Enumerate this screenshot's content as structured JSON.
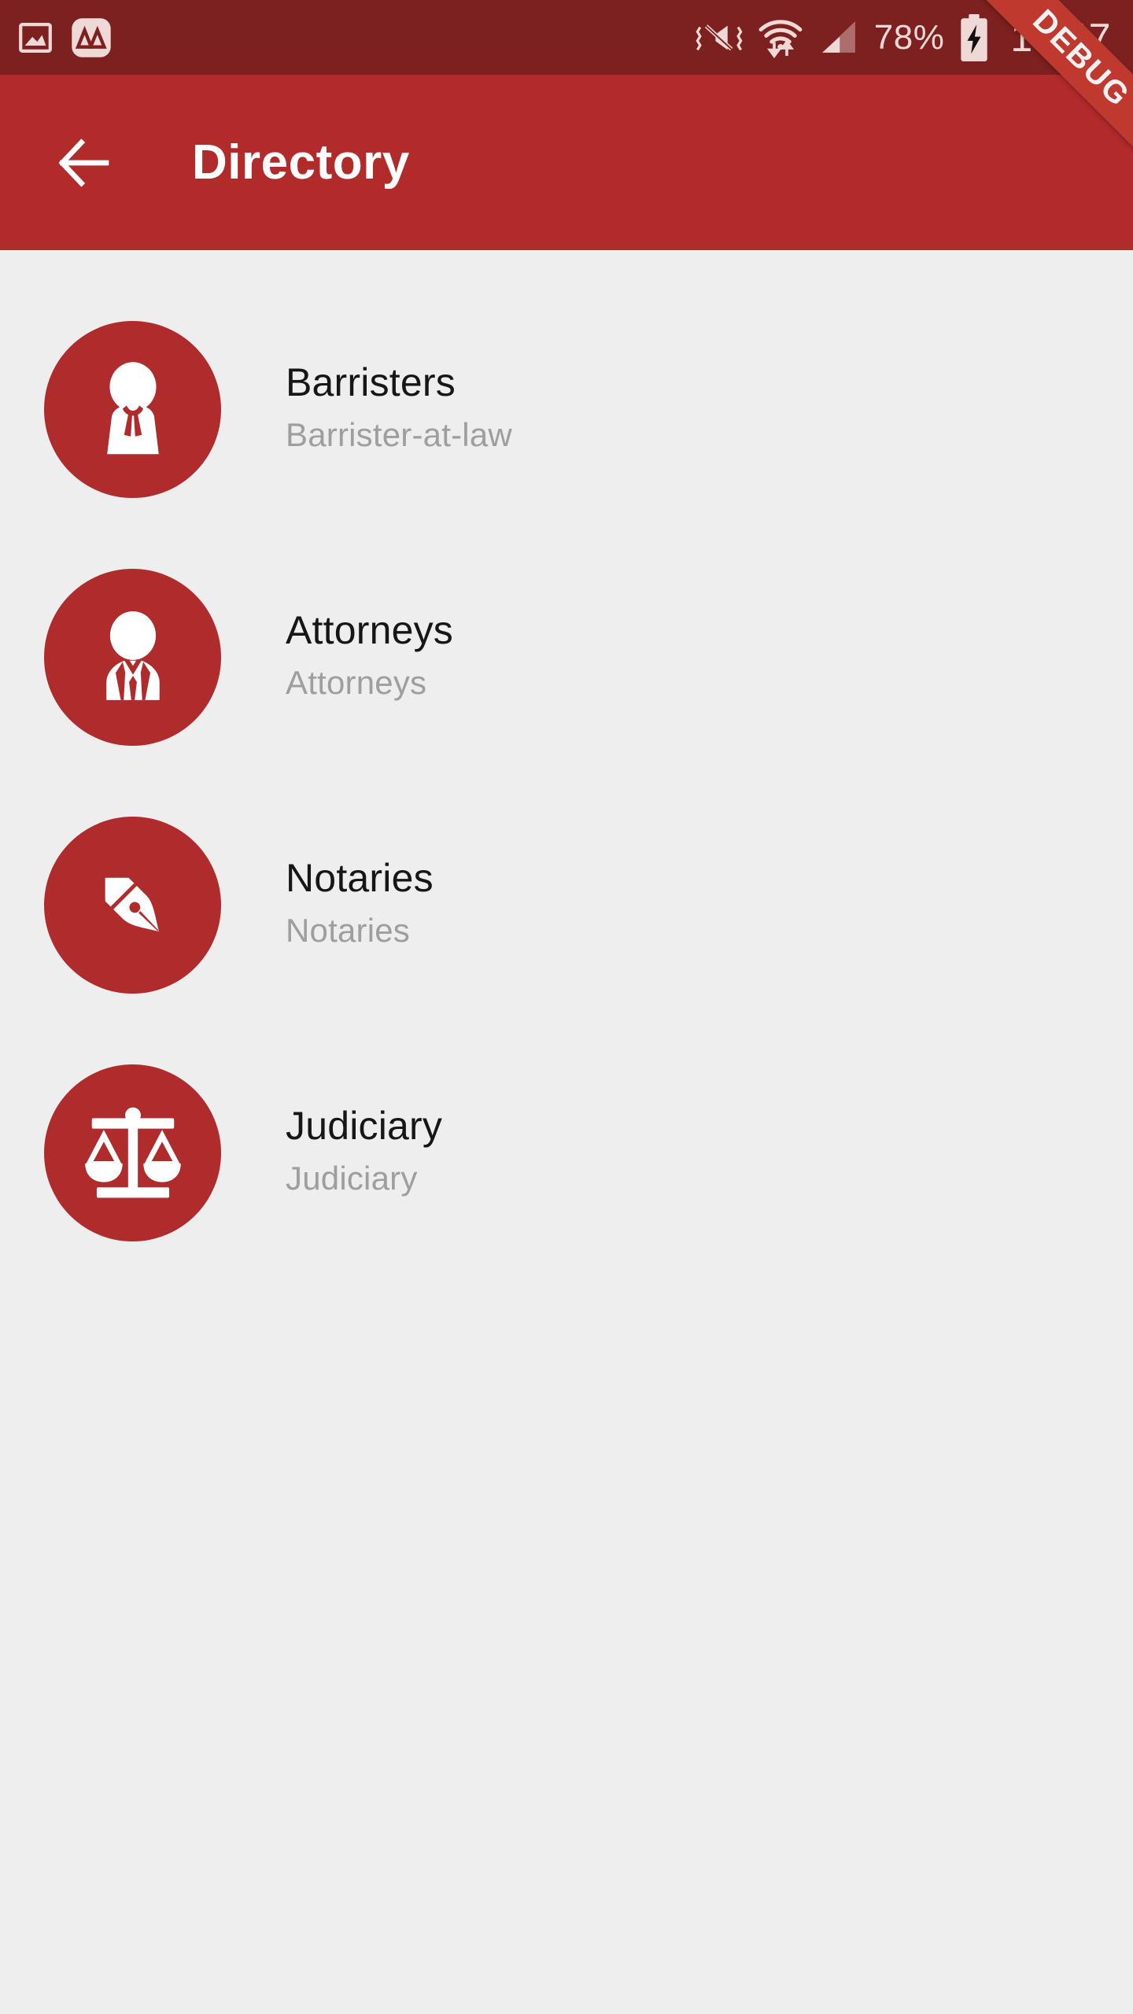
{
  "status_bar": {
    "battery_percent": "78%",
    "clock": "13:47",
    "left_icons": [
      {
        "name": "screenshot-image-icon"
      },
      {
        "name": "app-badge-mountain-icon"
      }
    ],
    "right_icons": [
      {
        "name": "vibrate-mute-icon"
      },
      {
        "name": "wifi-data-transfer-icon"
      },
      {
        "name": "cellular-signal-icon"
      },
      {
        "name": "battery-charging-icon"
      }
    ],
    "colors": {
      "background": "#7D2020",
      "foreground": "#EFD9D7"
    }
  },
  "debug_ribbon": {
    "label": "DEBUG",
    "color": "#C0392F"
  },
  "app_bar": {
    "back_icon": "arrow-back-icon",
    "title": "Directory",
    "color": "#B22B2B"
  },
  "directory": {
    "items": [
      {
        "title": "Barristers",
        "subtitle": "Barrister-at-law",
        "icon": "barrister-avatar-icon"
      },
      {
        "title": "Attorneys",
        "subtitle": "Attorneys",
        "icon": "attorney-avatar-icon"
      },
      {
        "title": "Notaries",
        "subtitle": "Notaries",
        "icon": "fountain-pen-nib-icon"
      },
      {
        "title": "Judiciary",
        "subtitle": "Judiciary",
        "icon": "scales-of-justice-icon"
      }
    ],
    "colors": {
      "background": "#EEEEEE",
      "avatar": "#B02B2B",
      "title": "#161616",
      "subtitle": "#9E9E9E"
    }
  }
}
